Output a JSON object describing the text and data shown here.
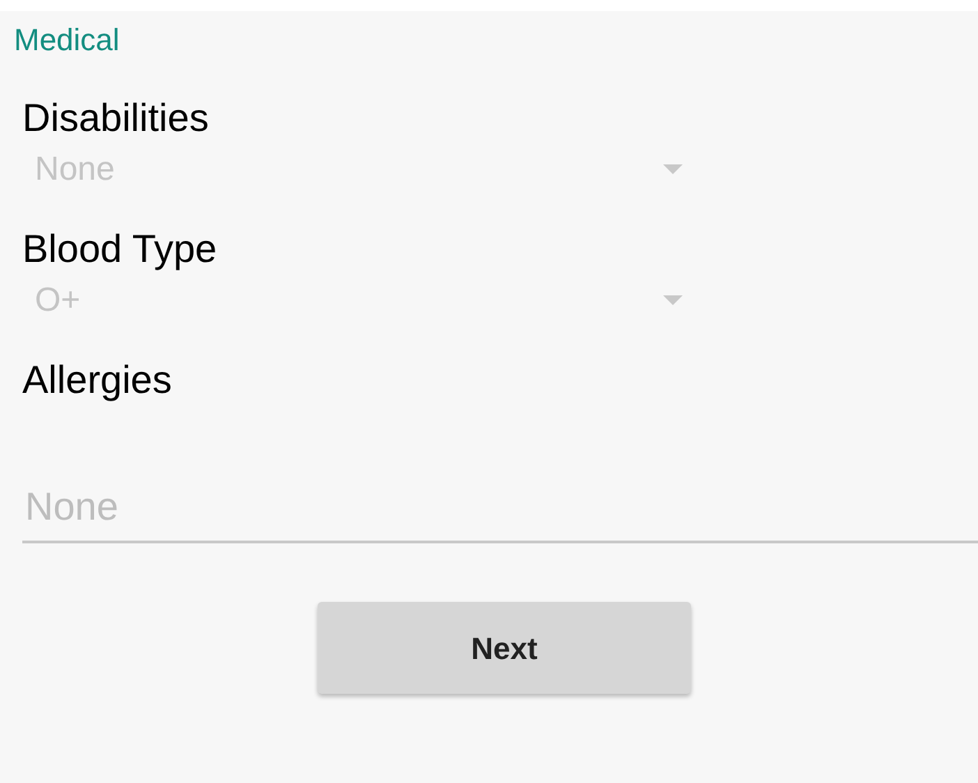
{
  "section_title": "Medical",
  "fields": [
    {
      "kind": "dropdown",
      "label": "Disabilities",
      "value": "None"
    },
    {
      "kind": "dropdown",
      "label": "Blood Type",
      "value": "O+"
    },
    {
      "kind": "text",
      "label": "Allergies",
      "placeholder": "None"
    }
  ],
  "buttons": [
    "Next"
  ]
}
